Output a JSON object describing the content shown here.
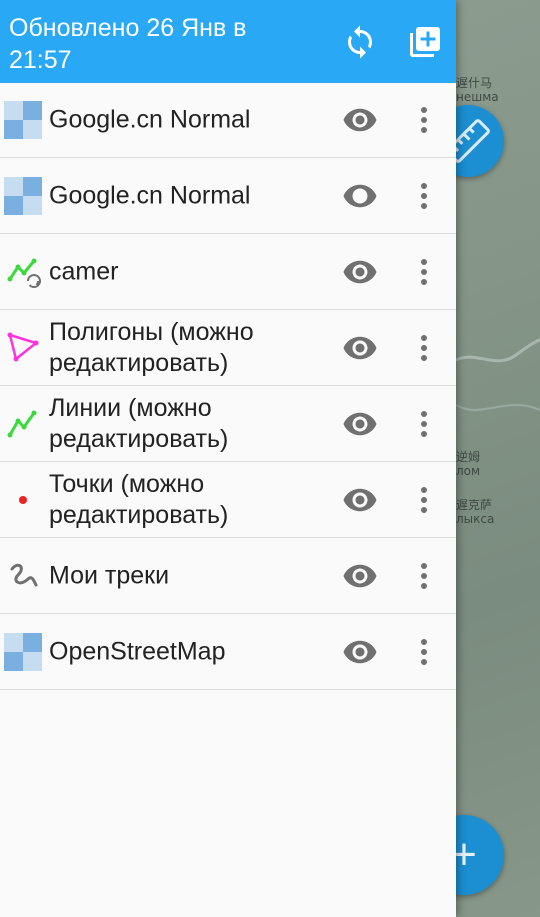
{
  "header": {
    "title": "Обновлено 26 Янв в 21:57",
    "refresh_icon": "refresh-icon",
    "add_layer_icon": "add-layer-icon",
    "color": "#29a9f5"
  },
  "layers": [
    {
      "label": "Google.cn Normal",
      "icon": "tile-layer-icon"
    },
    {
      "label": "Google.cn Normal",
      "icon": "tile-layer-icon"
    },
    {
      "label": "camer",
      "icon": "synced-line-icon"
    },
    {
      "label": "Полигоны (можно редактировать)",
      "icon": "polygon-icon"
    },
    {
      "label": "Линии (можно редактировать)",
      "icon": "line-icon"
    },
    {
      "label": "Точки (можно редактировать)",
      "icon": "point-icon"
    },
    {
      "label": "Мои треки",
      "icon": "track-icon"
    },
    {
      "label": "OpenStreetMap",
      "icon": "tile-layer-icon"
    }
  ],
  "row_actions": {
    "visibility_icon": "eye-icon",
    "menu_icon": "more-vert-icon"
  },
  "map": {
    "labels": [
      "遅什马",
      "нешма",
      "逆姆",
      "лом",
      "遅克萨",
      "лыкса"
    ],
    "fab_ruler_icon": "ruler-icon",
    "fab_add_icon": "plus-icon",
    "fab_add_glyph": "+"
  }
}
